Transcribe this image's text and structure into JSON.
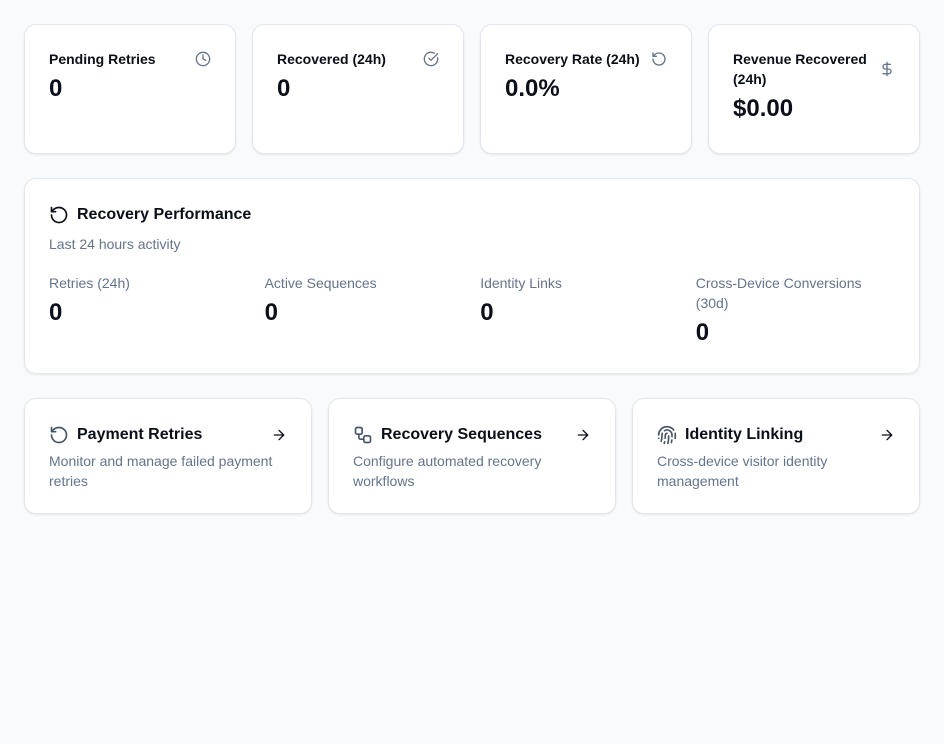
{
  "stats": [
    {
      "label": "Pending Retries",
      "value": "0",
      "icon": "clock-icon"
    },
    {
      "label": "Recovered (24h)",
      "value": "0",
      "icon": "check-circle-icon"
    },
    {
      "label": "Recovery Rate (24h)",
      "value": "0.0%",
      "icon": "rotate-ccw-icon"
    },
    {
      "label": "Revenue Recovered (24h)",
      "value": "$0.00",
      "icon": "dollar-icon"
    }
  ],
  "performance": {
    "title": "Recovery Performance",
    "subtitle": "Last 24 hours activity",
    "metrics": [
      {
        "label": "Retries (24h)",
        "value": "0"
      },
      {
        "label": "Active Sequences",
        "value": "0"
      },
      {
        "label": "Identity Links",
        "value": "0"
      },
      {
        "label": "Cross-Device Conversions (30d)",
        "value": "0"
      }
    ]
  },
  "nav_cards": [
    {
      "title": "Payment Retries",
      "description": "Monitor and manage failed payment retries",
      "icon": "rotate-ccw-icon"
    },
    {
      "title": "Recovery Sequences",
      "description": "Configure automated recovery workflows",
      "icon": "workflow-icon"
    },
    {
      "title": "Identity Linking",
      "description": "Cross-device visitor identity management",
      "icon": "fingerprint-icon"
    }
  ],
  "colors": {
    "muted": "#64748b",
    "border": "#e2e8f0",
    "background": "#f8fafc"
  }
}
